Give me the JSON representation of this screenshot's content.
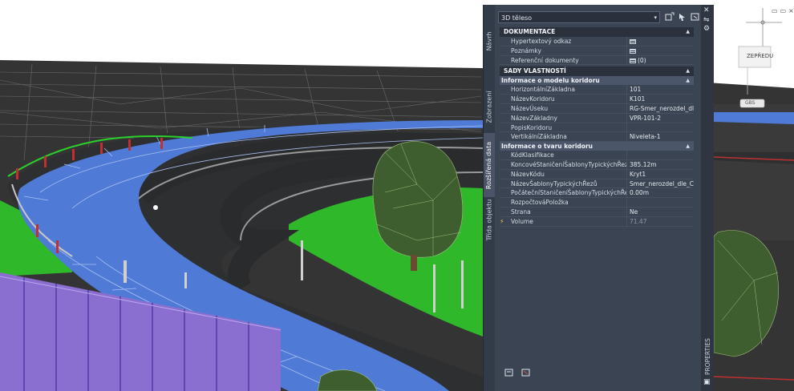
{
  "palette": {
    "object_type": "3D těleso",
    "title": "PROPERTIES",
    "side_tabs": [
      "Návrh",
      "Zobrazení",
      "Rozšířená data",
      "Třída objektu"
    ],
    "categories": [
      {
        "label": "DOKUMENTACE",
        "rows": [
          {
            "name": "Hypertextový odkaz",
            "value": "",
            "icon": "table-icon"
          },
          {
            "name": "Poznámky",
            "value": "",
            "icon": "table-icon"
          },
          {
            "name": "Referenční dokumenty",
            "value": "(0)",
            "icon": "table-icon"
          }
        ]
      }
    ],
    "property_sets": {
      "label": "SADY VLASTNOSTÍ",
      "groups": [
        {
          "label": "Informace o modelu koridoru",
          "rows": [
            {
              "name": "HorizontálníZákladna",
              "value": "101"
            },
            {
              "name": "NázevKoridoru",
              "value": "K101"
            },
            {
              "name": "NázevÚseku",
              "value": "RG-Smer_nerozdel_dl..."
            },
            {
              "name": "NázevZákladny",
              "value": "VPR-101-2"
            },
            {
              "name": "PopisKoridoru",
              "value": ""
            },
            {
              "name": "VertikálníZákladna",
              "value": "Niveleta-1"
            }
          ]
        },
        {
          "label": "Informace o tvaru koridoru",
          "rows": [
            {
              "name": "KódKlasifikace",
              "value": ""
            },
            {
              "name": "KoncovéStaničeníŠablonyTypickýchŘezů",
              "value": "385.12m"
            },
            {
              "name": "NázevKódu",
              "value": "Kryt1"
            },
            {
              "name": "NázevŠablonyTypickýchŘezů",
              "value": "Smer_nerozdel_dle_C..."
            },
            {
              "name": "PočátečníStaničeníŠablonyTypickýchŘezů",
              "value": "0.00m"
            },
            {
              "name": "RozpočtováPoložka",
              "value": ""
            },
            {
              "name": "Strana",
              "value": "Ne"
            },
            {
              "name": "Volume",
              "value": "71.47",
              "icon": "lightning-icon",
              "readonly": true
            }
          ]
        }
      ]
    }
  },
  "viewport": {
    "sign_text": "ZEPŘEDU",
    "wcs_label": "GBS"
  },
  "colors": {
    "road_blue": "#4f7bd6",
    "asphalt": "#2e2f31",
    "grass": "#2fb82a",
    "barrier": "#8a6fd0",
    "tree": "#3f5e2f",
    "palette_bg": "#3b4453"
  }
}
